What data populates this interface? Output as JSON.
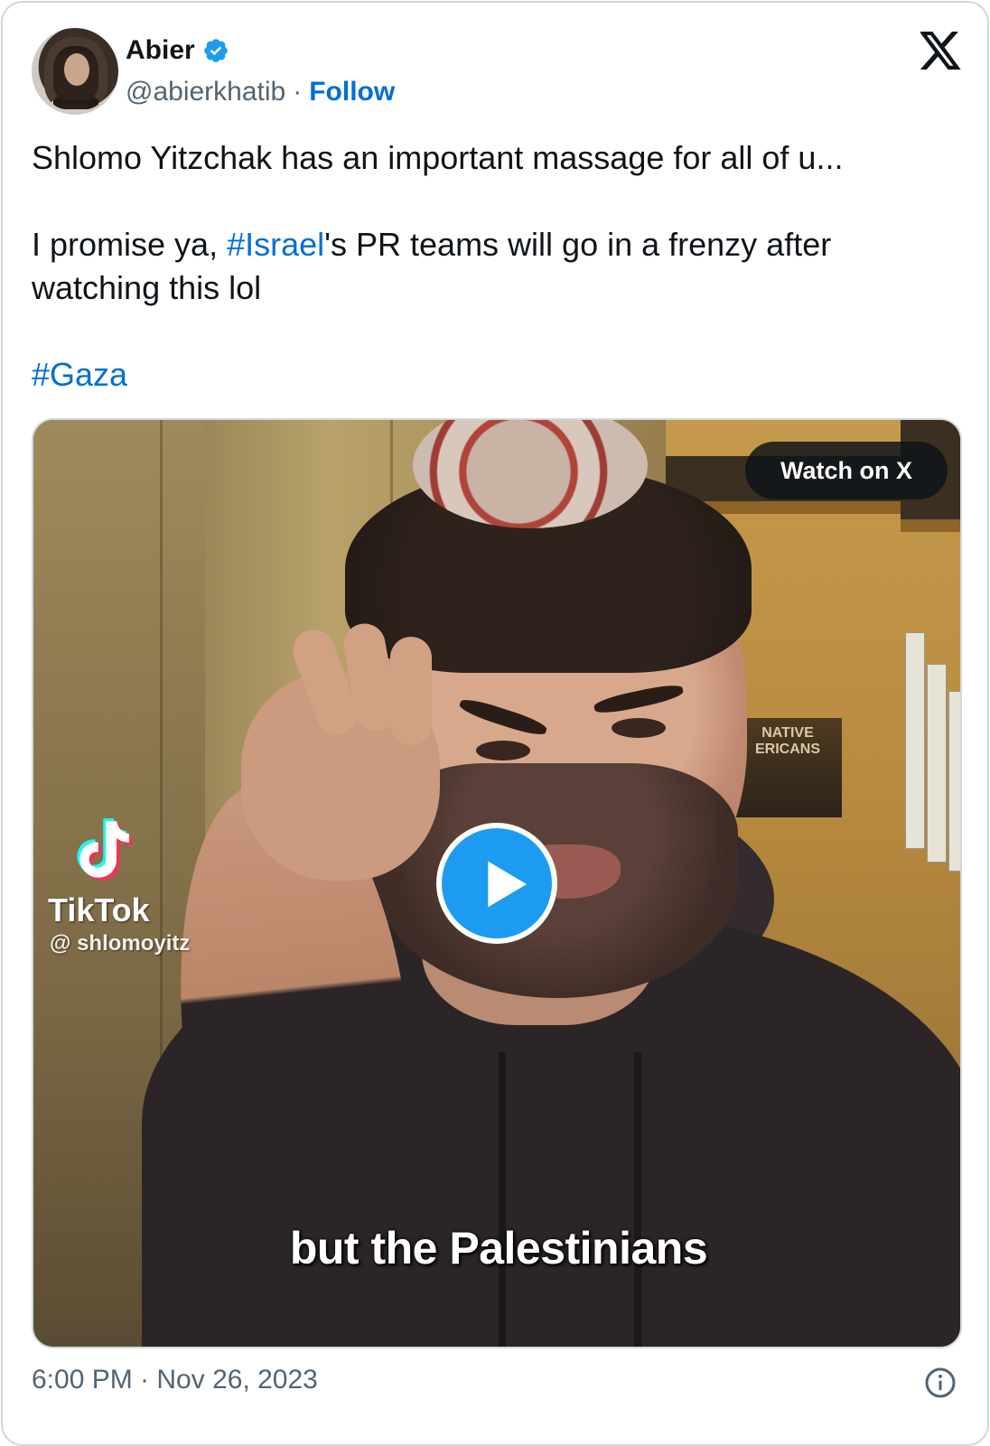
{
  "author": {
    "display_name": "Abier",
    "handle": "@abierkhatib",
    "separator": "·",
    "follow_label": "Follow",
    "verified": true
  },
  "tweet": {
    "line1": "Shlomo Yitzchak has an important massage for all of u...",
    "line2_prefix": "I promise ya, ",
    "line2_hashtag": "#Israel",
    "line2_suffix": "'s PR teams will go in a frenzy after watching this lol",
    "hashtag_gaza": "#Gaza"
  },
  "media": {
    "watch_label": "Watch on X",
    "tiktok_brand": "TikTok",
    "tiktok_handle": "@ shlomoyitz",
    "book_title_1": "NATIVE",
    "book_title_2": "ERICANS",
    "caption": "but the Palestinians"
  },
  "footer": {
    "timestamp": "6:00 PM · Nov 26, 2023"
  },
  "colors": {
    "accent": "#1d9bf0",
    "link": "#006fd6",
    "text": "#0f1419",
    "muted": "#536471",
    "border": "#cfd9de"
  },
  "icons": {
    "verified": "verified-badge-icon",
    "logo": "x-logo-icon",
    "play": "play-icon",
    "tiktok": "tiktok-logo-icon",
    "info": "info-icon"
  }
}
